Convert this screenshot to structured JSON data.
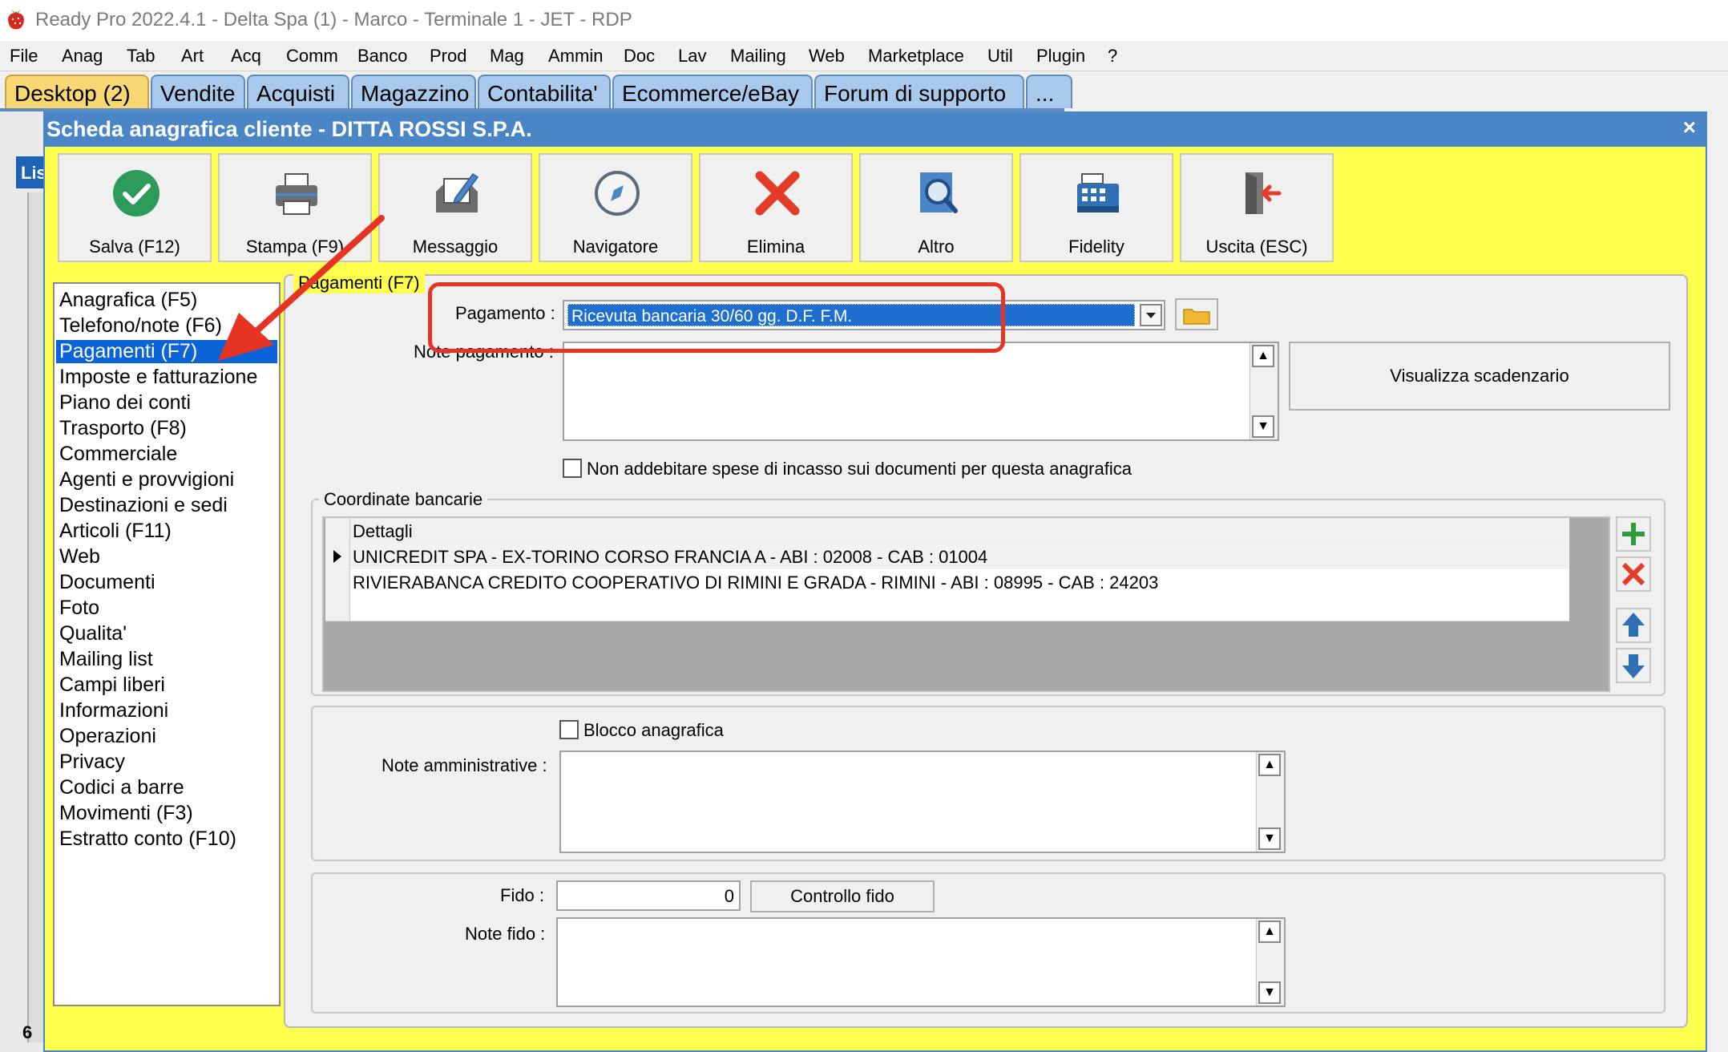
{
  "window": {
    "title": "Ready Pro 2022.4.1 - Delta Spa (1) - Marco - Terminale 1 - JET - RDP"
  },
  "menu": [
    "File",
    "Anag",
    "Tab",
    "Art",
    "Acq",
    "Comm",
    "Banco",
    "Prod",
    "Mag",
    "Ammin",
    "Doc",
    "Lav",
    "Mailing",
    "Web",
    "Marketplace",
    "Util",
    "Plugin",
    "?"
  ],
  "tabs": [
    "Desktop (2)",
    "Vendite",
    "Acquisti",
    "Magazzino",
    "Contabilita'",
    "Ecommerce/eBay",
    "Forum di supporto",
    "..."
  ],
  "background": {
    "strip": "Lis",
    "number": "6"
  },
  "dialog": {
    "title": "Scheda anagrafica cliente - DITTA ROSSI S.P.A.",
    "close": "×"
  },
  "toolbar": [
    "Salva (F12)",
    "Stampa (F9)",
    "Messaggio",
    "Navigatore",
    "Elimina",
    "Altro",
    "Fidelity",
    "Uscita (ESC)"
  ],
  "nav": [
    "Anagrafica (F5)",
    "Telefono/note (F6)",
    "Pagamenti (F7)",
    "Imposte e fatturazione",
    "Piano dei conti",
    "Trasporto (F8)",
    "Commerciale",
    "Agenti e provvigioni",
    "Destinazioni e sedi",
    "Articoli (F11)",
    "Web",
    "Documenti",
    "Foto",
    "Qualita'",
    "Mailing list",
    "Campi liberi",
    "Informazioni",
    "Operazioni",
    "Privacy",
    "Codici a barre",
    "Movimenti (F3)",
    "Estratto conto (F10)"
  ],
  "panel": {
    "group_title": "Pagamenti (F7)",
    "pagamento_label": "Pagamento :",
    "pagamento_value": "Ricevuta bancaria 30/60 gg. D.F. F.M.",
    "note_pagamento_label": "Note pagamento :",
    "visualizza_button": "Visualizza scadenzario",
    "non_addebitare": "Non addebitare spese di incasso sui documenti per questa anagrafica",
    "coordinate_title": "Coordinate bancarie",
    "grid_header": "Dettagli",
    "grid_rows": [
      "UNICREDIT SPA - EX-TORINO CORSO FRANCIA A - ABI : 02008 - CAB : 01004",
      "RIVIERABANCA CREDITO COOPERATIVO DI RIMINI E GRADA - RIMINI - ABI : 08995 - CAB : 24203"
    ],
    "blocco_label": "Blocco anagrafica",
    "note_amm_label": "Note amministrative :",
    "fido_label": "Fido :",
    "fido_value": "0",
    "controllo_fido": "Controllo fido",
    "note_fido_label": "Note fido :"
  },
  "colors": {
    "annotation": "#e53423",
    "selection": "#0a64d8",
    "dialog_bg": "#ffff4d",
    "title_blue": "#4a86c5"
  }
}
